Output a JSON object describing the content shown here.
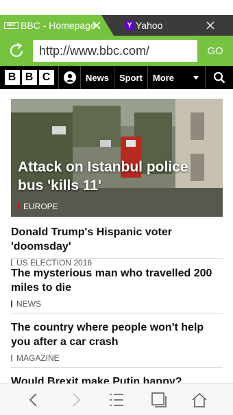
{
  "tabs": [
    {
      "label": "BBC - Homepage",
      "favicon": "BBC",
      "active": true
    },
    {
      "label": "Yahoo",
      "favicon": "Y",
      "active": false
    }
  ],
  "address_bar": {
    "url": "http://www.bbc.com/",
    "go_label": "GO"
  },
  "bbc_nav": {
    "logo_letters": [
      "B",
      "B",
      "C"
    ],
    "links": [
      "News",
      "Sport",
      "More"
    ]
  },
  "hero": {
    "title": "Attack on Istanbul police bus 'kills 11'",
    "tag": "EUROPE",
    "tag_color": "#bb1919"
  },
  "stories": [
    {
      "title": "Donald Trump's Hispanic voter 'doomsday'",
      "tag": "US ELECTION 2016",
      "tag_color": "#4da3d6"
    },
    {
      "title": "The mysterious man who travelled 200 miles to die",
      "tag": "NEWS",
      "tag_color": "#bb1919"
    },
    {
      "title": "The country where people won't help you after a car crash",
      "tag": "MAGAZINE",
      "tag_color": "#4da3d6"
    },
    {
      "title": "Would Brexit make Putin happy?",
      "tag": "",
      "tag_color": "#bb1919"
    }
  ],
  "colors": {
    "browser_accent": "#75c33f",
    "tab_strip": "#3b3b3b",
    "bbc_nav": "#000000"
  },
  "toolbar_icons": [
    "back-icon",
    "forward-icon",
    "menu-icon",
    "tabs-icon",
    "home-icon"
  ]
}
